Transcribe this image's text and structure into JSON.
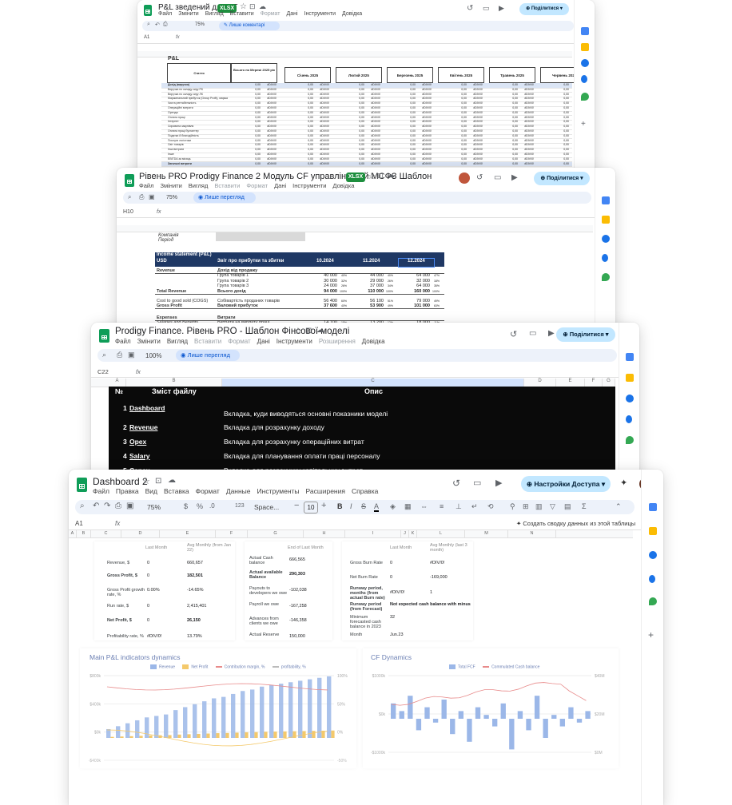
{
  "colors": {
    "accent": "#0b57d0",
    "share_bg": "#c2e7ff",
    "sheets_green": "#0f9d58",
    "header_navy": "#1f3864",
    "black_panel": "#0a0a0a",
    "link_red": "#ff2d2d",
    "bar_blue": "#9bb7e8",
    "bar_yellow": "#f4c96b",
    "line_red": "#e88a8a"
  },
  "win1": {
    "title": "P&L зведений для ТТ",
    "badge": "XLSX",
    "menu": [
      "Файл",
      "Змінити",
      "Вигляд",
      "Вставити",
      "Формат",
      "Дані",
      "Інструменти",
      "Довідка"
    ],
    "zoom": "75%",
    "mode": "Лише коментарі",
    "cell": "A1",
    "sheet_title": "P&L",
    "col_total": "Всього по Мережі 2025 рік",
    "months": [
      "Січень 2025",
      "Лютий 2025",
      "Березень 2025",
      "Квітень 2025",
      "Травень 2025",
      "Червень 202"
    ],
    "rows": [
      "Стаття",
      "Дохід (виручка)",
      "Виручка по складу сиру РК",
      "Виручка по складу сиру ЛК",
      "Маржинальний прибуток (Group Profit), маржа",
      "Чиста рентабельність",
      "Операційні витрати",
      "Оренда",
      "Оплата праці",
      "Інтернет",
      "Сировина закупівля",
      "Оплата праці бухгалтер",
      "Податки й благодійність",
      "Послуги логістики",
      "Світ товарів",
      "Інші витрати",
      "Інше",
      "EBITDA за місяць",
      "Загальні витрати"
    ],
    "zero": "0,00",
    "div": "#DIV/0!"
  },
  "win2": {
    "title": "Рівень PRO Prodigy Finance 2 Модуль CF управлінський МСФЗ Шаблон",
    "badge": "XLSX",
    "menu": [
      "Файл",
      "Змінити",
      "Вигляд",
      "Вставити",
      "Формат",
      "Дані",
      "Інструменти",
      "Довідка"
    ],
    "zoom": "75%",
    "mode": "Лише перегляд",
    "cell": "H10",
    "share": "Поділитися",
    "company_lbl": "Компанія",
    "period_lbl": "Період",
    "statement_title": "Income statement (P&L)",
    "currency": "USD",
    "report_name": "Звіт про прибутки та збитки",
    "periods": [
      "10.2024",
      "11.2024",
      "12.2024"
    ],
    "rows": [
      {
        "en": "Revenue",
        "ua": "Дохід від продажу",
        "vals": [
          "",
          "",
          ""
        ],
        "pct": [
          "",
          "",
          ""
        ]
      },
      {
        "en": "",
        "ua": "Група товарів 1",
        "vals": [
          "40 000",
          "44 000",
          "64 000"
        ],
        "pct": [
          "40%",
          "40%",
          "47%"
        ]
      },
      {
        "en": "",
        "ua": "Група товарів 2",
        "vals": [
          "30 000",
          "29 000",
          "32 000"
        ],
        "pct": [
          "32%",
          "26%",
          "18%"
        ]
      },
      {
        "en": "",
        "ua": "Група товарів 3",
        "vals": [
          "24 000",
          "37 000",
          "64 000"
        ],
        "pct": [
          "26%",
          "34%",
          "35%"
        ]
      },
      {
        "en": "Total Revenue",
        "ua": "Всього дохід",
        "vals": [
          "94 000",
          "110 000",
          "160 000"
        ],
        "pct": [
          "100%",
          "100%",
          "100%"
        ]
      },
      {
        "en": "Cost to good sold (COGS)",
        "ua": "Собівартість проданих товарів",
        "vals": [
          "56 400",
          "56 100",
          "79 000"
        ],
        "pct": [
          "60%",
          "51%",
          "49%"
        ]
      },
      {
        "en": "Gross Profit",
        "ua": "Валовий прибуток",
        "vals": [
          "37 600",
          "53 900",
          "101 000"
        ],
        "pct": [
          "40%",
          "49%",
          "63%"
        ]
      },
      {
        "en": "Expenses",
        "ua": "Витрати",
        "vals": [
          "",
          "",
          ""
        ],
        "pct": [
          "",
          "",
          ""
        ]
      },
      {
        "en": "Salaries and Benefits",
        "ua": "Витрати на виплату праці",
        "vals": [
          "14 100",
          "13 200",
          "18 000"
        ],
        "pct": [
          "15%",
          "12%",
          "11%"
        ]
      }
    ]
  },
  "win3": {
    "title": "Prodigy Finance. Рівень PRO - Шаблон Фінсової моделі",
    "menu": [
      "Файл",
      "Змінити",
      "Вигляд",
      "Вставити",
      "Формат",
      "Дані",
      "Інструменти",
      "Розширення",
      "Довідка"
    ],
    "zoom": "100%",
    "mode": "Лише перегляд",
    "cell": "C22",
    "share": "Поділитися",
    "cols": [
      "A",
      "B",
      "C",
      "D",
      "E",
      "F",
      "G"
    ],
    "head_no": "№",
    "head_content": "Зміст файлу",
    "head_desc": "Опис",
    "items": [
      {
        "n": "1",
        "name": "Dashboard",
        "desc": "Вкладка, куди виводяться основні показники моделі"
      },
      {
        "n": "2",
        "name": "Revenue",
        "desc": "Вкладка для розрахунку доходу"
      },
      {
        "n": "3",
        "name": "Opex",
        "desc": "Вкладка для розрахунку операційних витрат"
      },
      {
        "n": "4",
        "name": "Salary",
        "desc": "Вкладка для планування оплати праці персоналу"
      },
      {
        "n": "5",
        "name": "Capex",
        "desc": "Вкладка для розрахунку капітальних витрат"
      }
    ]
  },
  "win4": {
    "title": "Dashboard 2",
    "menu": [
      "Файл",
      "Правка",
      "Вид",
      "Вставка",
      "Формат",
      "Данные",
      "Инструменты",
      "Расширения",
      "Справка"
    ],
    "share": "Настройки Доступа",
    "zoom": "75%",
    "font": "Space...",
    "font_size": "10",
    "cell": "A1",
    "ai_hint": "Создать сводку данных из этой таблицы",
    "cols": [
      "A",
      "B",
      "C",
      "D",
      "E",
      "F",
      "G",
      "H",
      "I",
      "J",
      "K",
      "L",
      "M",
      "N"
    ],
    "panel1": {
      "h1": "Last Month",
      "h2": "Avg Monthly (from Jan 22)",
      "rows": [
        [
          "Revenue, $",
          "0",
          "660,657"
        ],
        [
          "Gross Profit, $",
          "0",
          "182,501"
        ],
        [
          "Gross Profit growth rate, %",
          "0.00%",
          "-14.65%"
        ],
        [
          "Run rate, $",
          "0",
          "2,415,401"
        ],
        [
          "Net Profit, $",
          "0",
          "26,150"
        ],
        [
          "Profitability rate, %",
          "#DIV/0!",
          "13.79%"
        ]
      ]
    },
    "panel2": {
      "h1": "End of Last Month",
      "rows": [
        [
          "Actual Cash balance",
          "666,565"
        ],
        [
          "Actual available Balance",
          "290,303"
        ],
        [
          "Payouts to developers we owe",
          "-102,038"
        ],
        [
          "Payroll we owe",
          "-167,258"
        ],
        [
          "Advances from clients we owe",
          "-146,358"
        ],
        [
          "Actual Reserve",
          "150,000"
        ]
      ]
    },
    "panel3": {
      "h1": "Last Month",
      "h2": "Avg Monthly (last 3 month)",
      "rows": [
        [
          "Gross Burn Rate",
          "0",
          "#DIV/0!"
        ],
        [
          "Net Burn Rate",
          "0",
          "-169,000"
        ],
        [
          "Runway period, months (from actual Burn rate)",
          "#DIV/0!",
          "1"
        ],
        [
          "Runway period (from Forecast)",
          "Not expected cash balance with minus",
          ""
        ],
        [
          "Minimum forecasted cash balance in 2023",
          "32",
          ""
        ],
        [
          "Month",
          "Jun.23",
          ""
        ]
      ]
    },
    "chart1": {
      "title": "Main P&L indicators dynamics",
      "legend": [
        "Revenue",
        "Net Profit",
        "Contribution margin, %",
        "profitability, %"
      ],
      "yleft": [
        "$800k",
        "$400k",
        "$0k",
        "-$400k"
      ],
      "yright": [
        "100%",
        "50%",
        "0%",
        "-50%"
      ],
      "chart_data": {
        "type": "bar",
        "series": [
          {
            "name": "Revenue",
            "values": [
              120,
              160,
              200,
              240,
              280,
              300,
              320,
              380,
              420,
              460,
              500,
              540,
              560,
              600,
              640,
              660,
              700,
              720,
              740,
              760,
              780,
              800,
              820,
              840
            ]
          }
        ]
      }
    },
    "chart2": {
      "title": "CF Dynamics",
      "legend": [
        "Total FCF",
        "Commulated Cash balance"
      ],
      "yleft": [
        "$1000k",
        "$0k",
        "-$1000k"
      ],
      "yright": [
        "$40M",
        "$20M",
        "$0M"
      ],
      "chart_data": {
        "type": "bar",
        "series": [
          {
            "name": "Total FCF",
            "values": [
              40,
              20,
              60,
              -30,
              30,
              -10,
              50,
              -40,
              20,
              -60,
              30,
              10,
              -20,
              40,
              -80,
              20,
              -30,
              60,
              -50,
              10,
              -20,
              30,
              -10,
              20
            ]
          }
        ]
      }
    }
  }
}
